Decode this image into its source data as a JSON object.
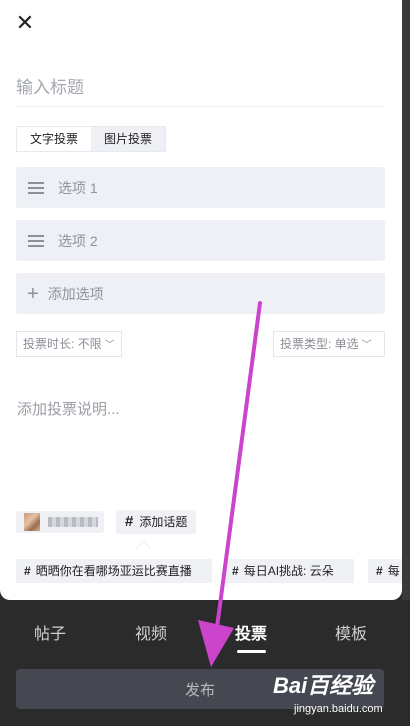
{
  "header": {
    "close_icon": "close-icon"
  },
  "form": {
    "title_placeholder": "输入标题",
    "vote_types": [
      "文字投票",
      "图片投票"
    ],
    "options": [
      {
        "label": "选项 1"
      },
      {
        "label": "选项 2"
      }
    ],
    "add_option_label": "添加选项",
    "duration_label": "投票时长: 不限",
    "type_label": "投票类型: 单选",
    "description_placeholder": "添加投票说明..."
  },
  "bottom": {
    "add_topic_label": "添加话题",
    "suggested_topics": [
      "晒晒你在看哪场亚运比赛直播",
      "每日AI挑战: 云朵",
      "每"
    ]
  },
  "tabs": [
    {
      "label": "帖子",
      "active": false
    },
    {
      "label": "视频",
      "active": false
    },
    {
      "label": "投票",
      "active": true
    },
    {
      "label": "模板",
      "active": false
    }
  ],
  "publish_label": "发布",
  "watermark": {
    "logo": "Bai百经验",
    "url": "jingyan.baidu.com"
  },
  "colors": {
    "annotation_arrow": "#cc44cc",
    "tab_bar_bg": "#2b2b2b",
    "option_bg": "#eef0f6"
  }
}
